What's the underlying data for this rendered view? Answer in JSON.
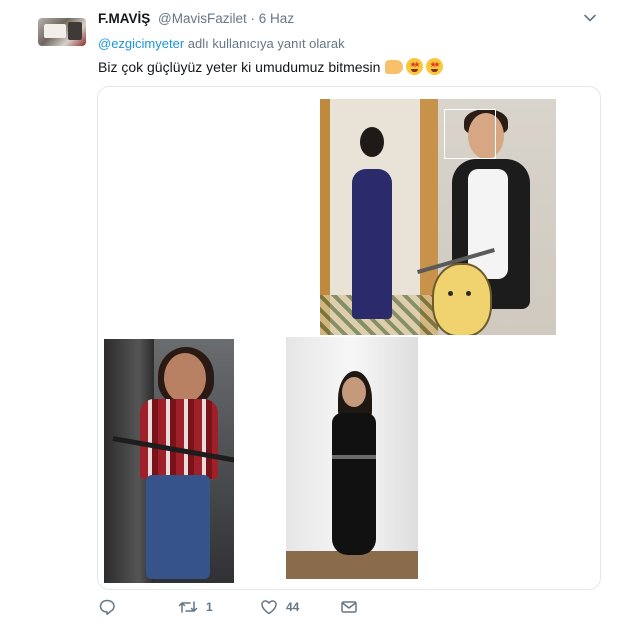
{
  "tweet": {
    "author_name": "F.MAVİŞ",
    "author_handle": "@MavisFazilet",
    "separator": "·",
    "date": "6 Haz",
    "replying_mention": "@ezgicimyeter",
    "replying_suffix": " adlı kullanıcıya yanıt olarak",
    "text": "Biz çok güçlüyüz yeter ki umudumuz bitmesin",
    "emojis": [
      "flexed-biceps",
      "star-struck",
      "star-struck"
    ]
  },
  "media": {
    "images": [
      {
        "description_icon": "photo-before-after-mirror"
      },
      {
        "description_icon": "photo-plaid-shirt"
      },
      {
        "description_icon": "photo-black-dress"
      }
    ]
  },
  "actions": {
    "reply_count": "",
    "retweet_count": "1",
    "like_count": "44",
    "dm_count": ""
  },
  "colors": {
    "text_primary": "#14171a",
    "text_secondary": "#657786",
    "link": "#1b95e0",
    "border": "#e1e8ed"
  }
}
